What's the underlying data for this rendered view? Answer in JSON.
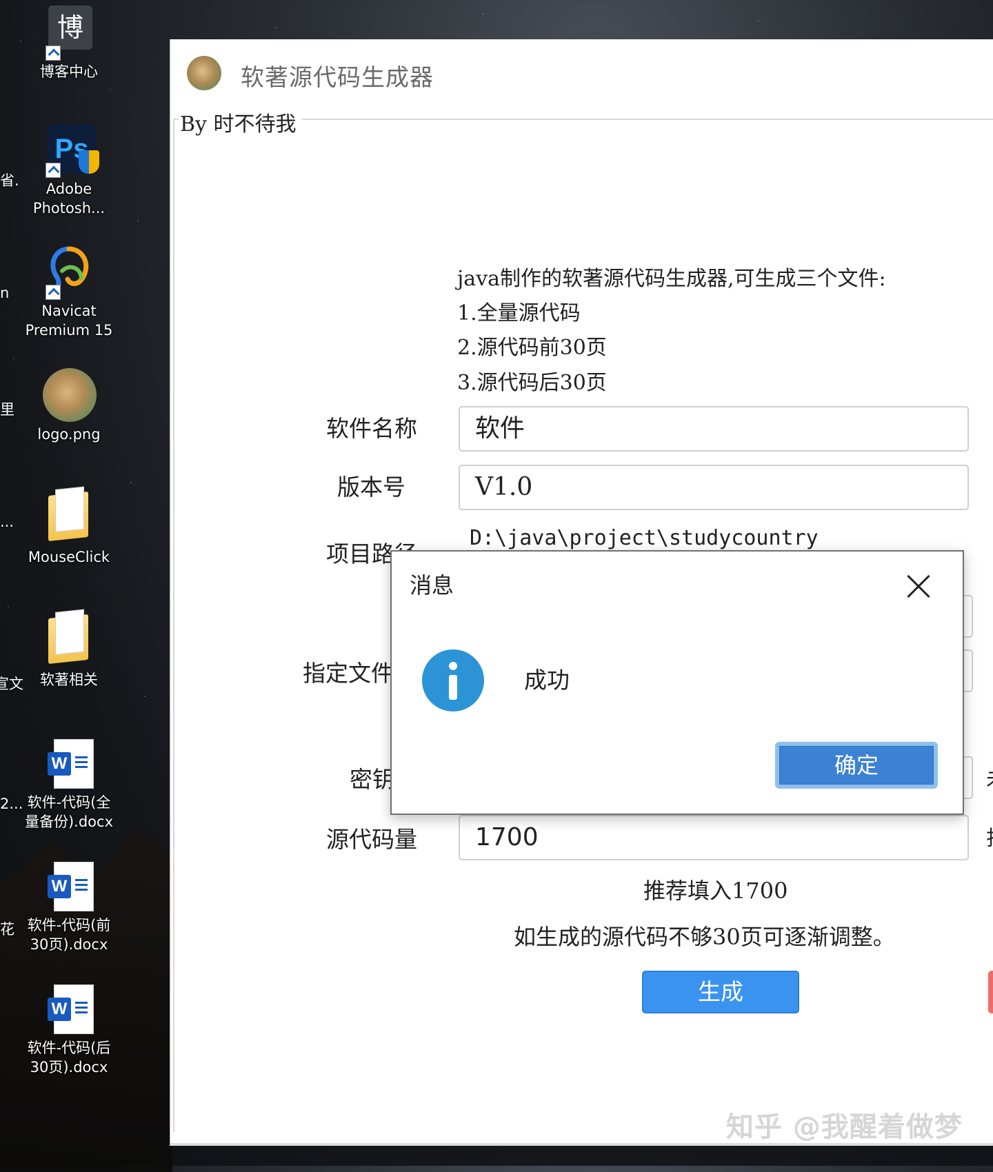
{
  "desktop": {
    "icons": [
      {
        "label": "博客中心",
        "glyph": "博"
      },
      {
        "label": "Adobe Photosh...",
        "glyph": "Ps"
      },
      {
        "label": "Navicat Premium 15"
      },
      {
        "label": "logo.png"
      },
      {
        "label": "MouseClick"
      },
      {
        "label": "软著相关"
      },
      {
        "label": "软件-代码(全量备份).docx",
        "glyph": "W"
      },
      {
        "label": "软件-代码(前30页).docx",
        "glyph": "W"
      },
      {
        "label": "软件-代码(后30页).docx",
        "glyph": "W"
      }
    ],
    "clipped_labels": [
      "省.",
      "n",
      "里",
      "...",
      "宣文",
      "2...",
      "花"
    ]
  },
  "window": {
    "title": "软著源代码生成器",
    "group_title": "By 时不待我"
  },
  "description": {
    "intro": "java制作的软著源代码生成器,可生成三个文件:",
    "items": [
      "1.全量源代码",
      "2.源代码前30页",
      "3.源代码后30页"
    ]
  },
  "form": {
    "software_name_label": "软件名称",
    "software_name_value": "软件",
    "version_label": "版本号",
    "version_value": "V1.0",
    "project_path_label": "项目路径",
    "project_path_value": "D:\\java\\project\\studycountry",
    "specify_file_label": "指定文件",
    "key_label": "密钥",
    "source_lines_label": "源代码量",
    "source_lines_value": "1700",
    "edge_chars": [
      "未",
      "打"
    ]
  },
  "hints": {
    "recommend": "推荐填入1700",
    "adjust": "如生成的源代码不够30页可逐渐调整。"
  },
  "actions": {
    "generate_label": "生成"
  },
  "dialog": {
    "title": "消息",
    "message": "成功",
    "ok_label": "确定"
  },
  "watermark": "知乎 @我醒着做梦",
  "colors": {
    "primary_button": "#3b93f0",
    "info_icon": "#2b93d6",
    "ok_button": "#3c82d4"
  }
}
